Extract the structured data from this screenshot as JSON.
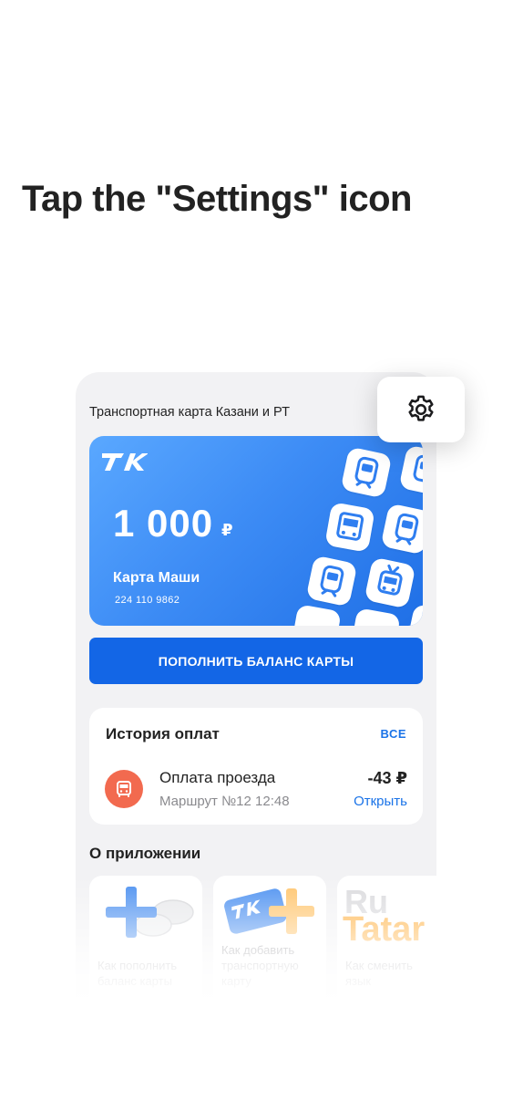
{
  "instruction": "Tap the \"Settings\" icon",
  "app": {
    "card_section_title": "Транспортная карта Казани и РТ",
    "card": {
      "logo_text": "ТК",
      "balance": "1 000",
      "currency": "₽",
      "name": "Карта Маши",
      "number": "224 110 9862"
    },
    "topup_button": "ПОПОЛНИТЬ БАЛАНС КАРТЫ",
    "history": {
      "title": "История оплат",
      "all_link": "ВСЕ",
      "items": [
        {
          "title": "Оплата проезда",
          "route": "Маршрут №12  12:48",
          "amount": "-43 ₽",
          "action": "Открыть",
          "icon": "bus-icon"
        }
      ]
    },
    "about": {
      "title": "О приложении",
      "cards": [
        {
          "caption_line1": "Как пополнить",
          "caption_line2": "баланс карты"
        },
        {
          "caption_line1": "Как добавить",
          "caption_line2": "транспортную",
          "caption_line3": "карту",
          "logo_text": "ТК"
        },
        {
          "caption_line1": "Как сменить",
          "caption_line2": "язык",
          "art_top": "Ru",
          "art_bottom": "Tatar"
        }
      ]
    },
    "settings_icon": "gear-icon"
  },
  "colors": {
    "accent_blue": "#1366e6",
    "link_blue": "#1a73e8",
    "card_gradient_start": "#5aa8ff",
    "card_gradient_end": "#1f6fe6",
    "bus_badge": "#f26a4f",
    "plus_blue": "#4a8ff0",
    "plus_orange": "#ffb347",
    "background": "#f2f2f4"
  }
}
